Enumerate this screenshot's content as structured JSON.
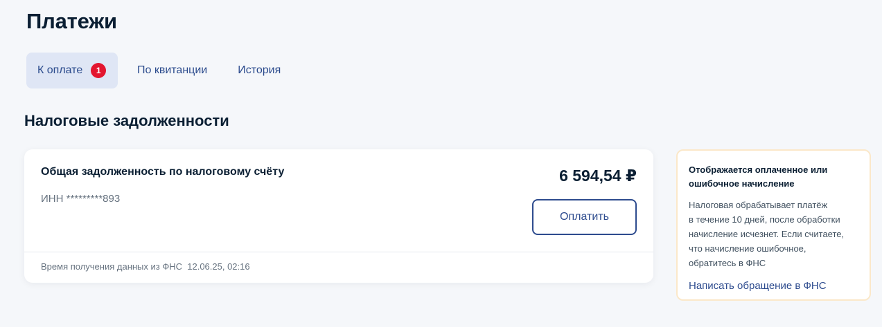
{
  "page": {
    "title": "Платежи"
  },
  "tabs": [
    {
      "label": "К оплате",
      "badge": "1",
      "active": true
    },
    {
      "label": "По квитанции"
    },
    {
      "label": "История"
    }
  ],
  "section": {
    "title": "Налоговые задолженности"
  },
  "debt_card": {
    "name": "Общая задолженность по налоговому счёту",
    "inn": "ИНН *********893",
    "amount": "6 594,54 ₽",
    "pay_button": "Оплатить",
    "fns_time_label": "Время получения данных из ФНС",
    "fns_time_value": "12.06.25, 02:16"
  },
  "info_box": {
    "title_line1": "Отображается оплаченное или",
    "title_line2": "ошибочное начисление",
    "text_line1": "Налоговая обрабатывает платёж",
    "text_line2": "в течение 10 дней, после обработки",
    "text_line3": "начисление исчезнет. Если считаете,",
    "text_line4": "что начисление ошибочное,",
    "text_line5": "обратитесь в ФНС",
    "link": "Написать обращение в ФНС"
  },
  "colors": {
    "badge": "#e3152f",
    "accent": "#2d4b8e",
    "active_tab_bg": "#dfe6f5",
    "info_border": "#fbe8c9"
  }
}
